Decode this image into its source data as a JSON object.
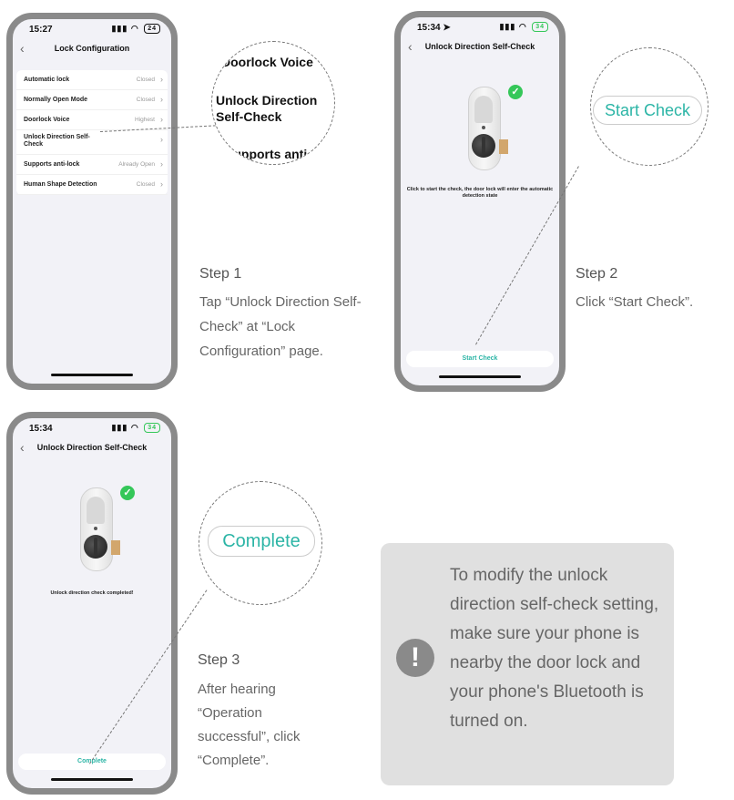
{
  "phone1": {
    "time": "15:27",
    "battery": "24",
    "title": "Lock Configuration",
    "rows": [
      {
        "label": "Automatic lock",
        "value": "Closed"
      },
      {
        "label": "Normally Open Mode",
        "value": "Closed"
      },
      {
        "label": "Doorlock Voice",
        "value": "Highest"
      },
      {
        "label": "Unlock Direction Self-Check",
        "value": ""
      },
      {
        "label": "Supports anti-lock",
        "value": "Already Open"
      },
      {
        "label": "Human Shape Detection",
        "value": "Closed"
      }
    ]
  },
  "zoom1": {
    "top": "Doorlock Voice",
    "middle": "Unlock Direction Self-Check",
    "bottom": "Supports anti-"
  },
  "phone2": {
    "time": "15:34",
    "battery": "34",
    "title": "Unlock Direction Self-Check",
    "caption": "Click to start the check, the door lock will enter the automatic detection state",
    "button": "Start Check"
  },
  "zoom2": {
    "label": "Start Check"
  },
  "phone3": {
    "time": "15:34",
    "battery": "34",
    "title": "Unlock Direction Self-Check",
    "caption": "Unlock direction check completed!",
    "button": "Complete"
  },
  "zoom3": {
    "label": "Complete"
  },
  "steps": {
    "step1": {
      "title": "Step 1",
      "text": "Tap “Unlock Direction Self-Check” at “Lock Configuration” page."
    },
    "step2": {
      "title": "Step 2",
      "text": "Click “Start Check”."
    },
    "step3": {
      "title": "Step 3",
      "text": "After hearing “Operation successful”, click “Complete”."
    }
  },
  "notice": {
    "icon": "exclamation-icon",
    "text": "To modify the unlock direction self-check setting, make sure your phone is nearby the door lock and your phone's Bluetooth is turned on."
  },
  "colors": {
    "accent": "#2cb5a6",
    "check": "#35c759",
    "frame": "#8a8a8a"
  }
}
